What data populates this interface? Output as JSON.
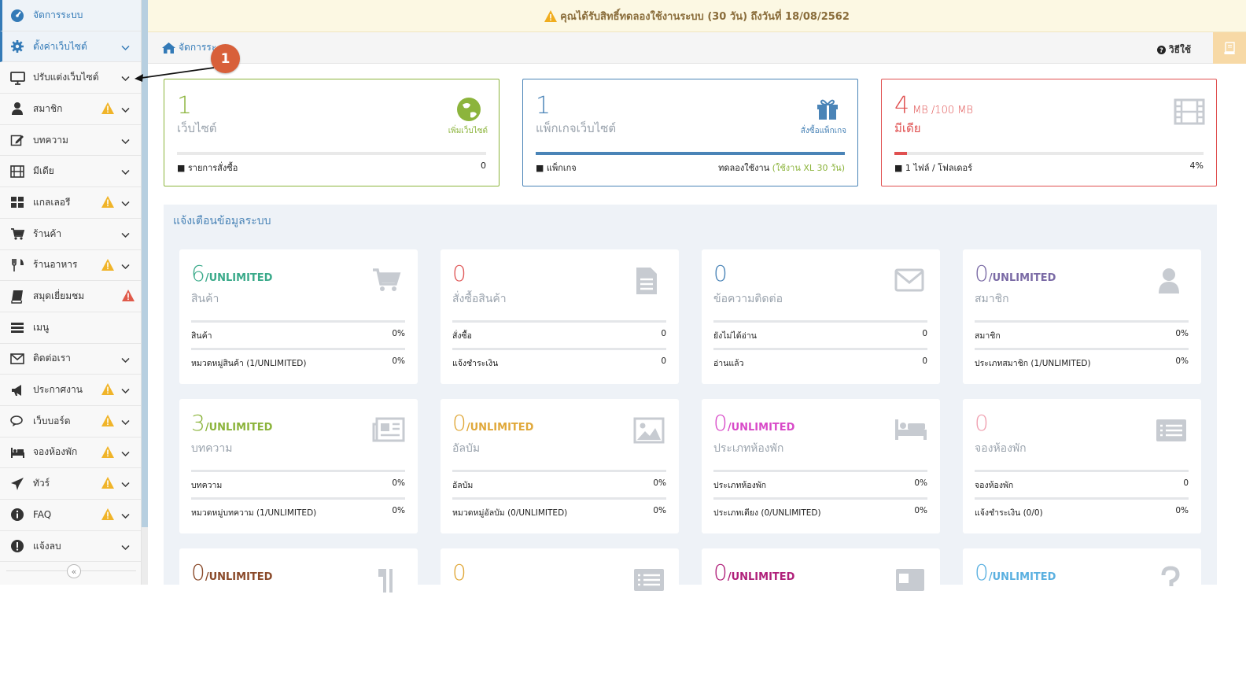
{
  "sidebar": {
    "items": [
      {
        "label": "จัดการระบบ",
        "icon": "dashboard-icon",
        "active": true,
        "warn": false,
        "chevron": false
      },
      {
        "label": "ตั้งค่าเว็บไซต์",
        "icon": "gear-icon",
        "active": true,
        "warn": false,
        "chevron": true
      },
      {
        "label": "ปรับแต่งเว็บไซต์",
        "icon": "monitor-icon",
        "active": false,
        "warn": false,
        "chevron": true
      },
      {
        "label": "สมาชิก",
        "icon": "user-icon",
        "active": false,
        "warn": true,
        "chevron": true
      },
      {
        "label": "บทความ",
        "icon": "edit-icon",
        "active": false,
        "warn": false,
        "chevron": true
      },
      {
        "label": "มีเดีย",
        "icon": "film-icon",
        "active": false,
        "warn": false,
        "chevron": true
      },
      {
        "label": "แกลเลอรี",
        "icon": "grid-icon",
        "active": false,
        "warn": true,
        "chevron": true
      },
      {
        "label": "ร้านค้า",
        "icon": "cart-icon",
        "active": false,
        "warn": false,
        "chevron": true
      },
      {
        "label": "ร้านอาหาร",
        "icon": "cutlery-icon",
        "active": false,
        "warn": true,
        "chevron": true
      },
      {
        "label": "สมุดเยี่ยมชม",
        "icon": "book-icon",
        "active": false,
        "warn": true,
        "chevron": false
      },
      {
        "label": "เมนู",
        "icon": "menu-icon",
        "active": false,
        "warn": false,
        "chevron": false
      },
      {
        "label": "ติดต่อเรา",
        "icon": "envelope-icon",
        "active": false,
        "warn": false,
        "chevron": true
      },
      {
        "label": "ประกาศงาน",
        "icon": "bullhorn-icon",
        "active": false,
        "warn": true,
        "chevron": true
      },
      {
        "label": "เว็บบอร์ด",
        "icon": "comments-icon",
        "active": false,
        "warn": true,
        "chevron": true
      },
      {
        "label": "จองห้องพัก",
        "icon": "bed-icon",
        "active": false,
        "warn": true,
        "chevron": true
      },
      {
        "label": "ทัวร์",
        "icon": "plane-icon",
        "active": false,
        "warn": true,
        "chevron": true
      },
      {
        "label": "FAQ",
        "icon": "info-icon",
        "active": false,
        "warn": true,
        "chevron": true
      },
      {
        "label": "แจ้งลบ",
        "icon": "exclamation-icon",
        "active": false,
        "warn": false,
        "chevron": true
      }
    ],
    "collapse": "«"
  },
  "topbar": {
    "notice": "คุณได้รับสิทธิ์ทดลองใช้งานระบบ (30 วัน) ถึงวันที่ 18/08/2562"
  },
  "breadcrumb": {
    "label": "จัดการระ",
    "howto": "วิธีใช้"
  },
  "annotation": {
    "number": "1"
  },
  "stats": [
    {
      "num": "1",
      "unit": "",
      "name": "เว็บไซต์",
      "iconlabel": "เพิ่มเว็บไซต์",
      "foot_left": "รายการสั่งซื้อ",
      "foot_right": "0",
      "foot_right_accent": "",
      "color": "#8cb43c",
      "fill": 0,
      "fill_color": "#8cb43c"
    },
    {
      "num": "1",
      "unit": "",
      "name": "แพ็กเกจเว็บไซต์",
      "iconlabel": "สั่งซื้อแพ็กเกจ",
      "foot_left": "แพ็กเกจ",
      "foot_right": "ทดลองใช้งาน",
      "foot_right_accent": "(ใช้งาน XL 30 วัน)",
      "color": "#4a84b7",
      "fill": 1,
      "fill_color": "#4a84b7"
    },
    {
      "num": "4",
      "unit": "MB  /100 MB",
      "name": "มีเดีย",
      "iconlabel": "",
      "foot_left": "1 ไฟล์ / โฟลเดอร์",
      "foot_right": "4%",
      "foot_right_accent": "",
      "color": "#e05050",
      "fill": 0.04,
      "fill_color": "#e05050"
    }
  ],
  "panel": {
    "title": "แจ้งเตือนข้อมูลระบบ"
  },
  "cards": [
    {
      "num": "6",
      "suf": "/UNLIMITED",
      "name": "สินค้า",
      "color": "#3aaa8a",
      "icon": "cart-icon",
      "rows": [
        [
          "สินค้า",
          "0%"
        ],
        [
          "หมวดหมู่สินค้า (1/UNLIMITED)",
          "0%"
        ]
      ]
    },
    {
      "num": "0",
      "suf": "",
      "name": "สั่งซื้อสินค้า",
      "color": "#e05a5a",
      "icon": "file-icon",
      "rows": [
        [
          "สั่งซื้อ",
          "0"
        ],
        [
          "แจ้งชำระเงิน",
          "0"
        ]
      ]
    },
    {
      "num": "0",
      "suf": "",
      "name": "ข้อความติดต่อ",
      "color": "#4a84b7",
      "icon": "envelope-icon",
      "rows": [
        [
          "ยังไม่ได้อ่าน",
          "0"
        ],
        [
          "อ่านแล้ว",
          "0"
        ]
      ]
    },
    {
      "num": "0",
      "suf": "/UNLIMITED",
      "name": "สมาชิก",
      "color": "#7a6aa5",
      "icon": "user-icon",
      "rows": [
        [
          "สมาชิก",
          "0%"
        ],
        [
          "ประเภทสมาชิก (1/UNLIMITED)",
          "0%"
        ]
      ]
    },
    {
      "num": "3",
      "suf": "/UNLIMITED",
      "name": "บทความ",
      "color": "#8cb43c",
      "icon": "newspaper-icon",
      "rows": [
        [
          "บทความ",
          "0%"
        ],
        [
          "หมวดหมู่บทความ (1/UNLIMITED)",
          "0%"
        ]
      ]
    },
    {
      "num": "0",
      "suf": "/UNLIMITED",
      "name": "อัลบัม",
      "color": "#e0a83a",
      "icon": "image-icon",
      "rows": [
        [
          "อัลบัม",
          "0%"
        ],
        [
          "หมวดหมู่อัลบัม (0/UNLIMITED)",
          "0%"
        ]
      ]
    },
    {
      "num": "0",
      "suf": "/UNLIMITED",
      "name": "ประเภทห้องพัก",
      "color": "#d84ac8",
      "icon": "bed-icon",
      "rows": [
        [
          "ประเภทห้องพัก",
          "0%"
        ],
        [
          "ประเภทเตียง (0/UNLIMITED)",
          "0%"
        ]
      ]
    },
    {
      "num": "0",
      "suf": "",
      "name": "จองห้องพัก",
      "color": "#f0a0b0",
      "icon": "list-icon",
      "rows": [
        [
          "จองห้องพัก",
          "0"
        ],
        [
          "แจ้งชำระเงิน (0/0)",
          "0%"
        ]
      ]
    },
    {
      "num": "0",
      "suf": "/UNLIMITED",
      "name": "",
      "color": "#8a4a2a",
      "icon": "cutlery-icon",
      "rows": []
    },
    {
      "num": "0",
      "suf": "",
      "name": "",
      "color": "#e0a83a",
      "icon": "list-icon",
      "rows": []
    },
    {
      "num": "0",
      "suf": "/UNLIMITED",
      "name": "",
      "color": "#b0207a",
      "icon": "id-card-icon",
      "rows": []
    },
    {
      "num": "0",
      "suf": "/UNLIMITED",
      "name": "",
      "color": "#5ab0e0",
      "icon": "question-icon",
      "rows": []
    }
  ]
}
